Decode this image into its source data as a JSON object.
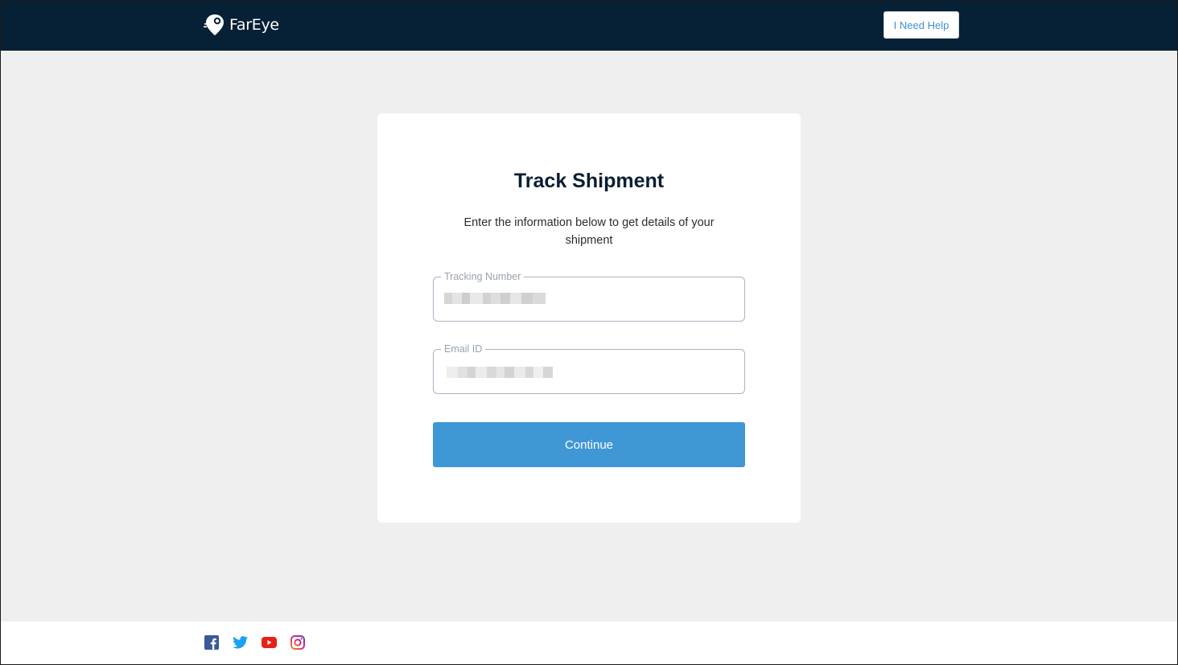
{
  "header": {
    "logo_text": "FarEye",
    "help_button": "I Need Help"
  },
  "form": {
    "title": "Track Shipment",
    "subtitle": "Enter the information below to get details of your shipment",
    "tracking_label": "Tracking Number",
    "email_label": "Email ID",
    "tracking_value_note": "obscured",
    "email_value_note": "obscured",
    "continue_button": "Continue"
  },
  "footer": {
    "social_icons": [
      "facebook-icon",
      "twitter-icon",
      "youtube-icon",
      "instagram-icon"
    ]
  },
  "colors": {
    "header_bg": "#062035",
    "page_bg": "#efefef",
    "accent": "#3f97d6",
    "help_text": "#3d8fd1"
  }
}
